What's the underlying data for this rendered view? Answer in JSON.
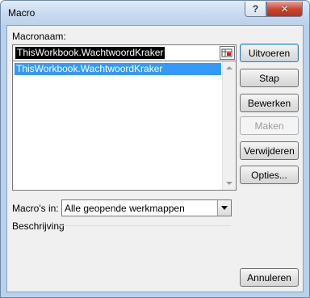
{
  "window": {
    "title": "Macro"
  },
  "titlebar": {
    "help_label": "?",
    "close_label": "✕"
  },
  "macro_name": {
    "label": "Macronaam:",
    "value": "ThisWorkbook.WachtwoordKraker"
  },
  "macro_list": {
    "items": [
      "ThisWorkbook.WachtwoordKraker"
    ],
    "selected_index": 0
  },
  "buttons": {
    "run": "Uitvoeren",
    "step": "Stap",
    "edit": "Bewerken",
    "create": "Maken",
    "delete": "Verwijderen",
    "options": "Opties...",
    "cancel": "Annuleren"
  },
  "macros_in": {
    "label": "Macro's in:",
    "value": "Alle geopende werkmappen"
  },
  "description": {
    "label": "Beschrijving",
    "value": ""
  },
  "colors": {
    "selection": "#3399ff",
    "client_bg": "#f0f0f0",
    "frame": "#b9d1ea"
  }
}
